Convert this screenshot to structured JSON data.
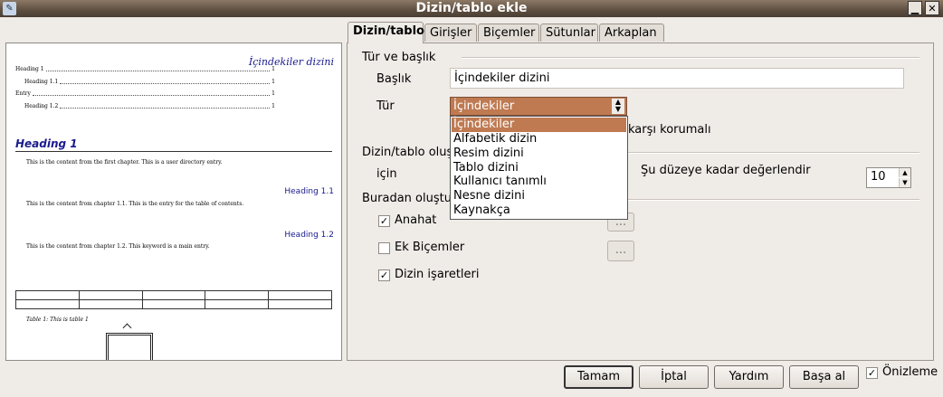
{
  "window": {
    "title": "Dizin/tablo ekle",
    "app_icon": "office-app-icon"
  },
  "tabs": [
    {
      "label": "Dizin/tablo"
    },
    {
      "label": "Girişler"
    },
    {
      "label": "Biçemler"
    },
    {
      "label": "Sütunlar"
    },
    {
      "label": "Arkaplan"
    }
  ],
  "preview": {
    "toc_title": "İçindekiler dizini",
    "toc_entries": [
      {
        "text": "Heading 1",
        "page": "1"
      },
      {
        "text": "Heading 1.1",
        "page": "1"
      },
      {
        "text": "Entry",
        "page": "1"
      },
      {
        "text": "Heading 1.2",
        "page": "1"
      }
    ],
    "heading1": "Heading 1",
    "body1": "This is the content from the first chapter. This is a user directory entry.",
    "heading11": "Heading 1.1",
    "body2": "This is the content from chapter 1.1. This is the entry for the table of contents.",
    "heading12": "Heading 1.2",
    "body3": "This is the content from chapter 1.2. This keyword is a main entry.",
    "caption": "Table 1: This is table 1"
  },
  "form": {
    "section_type": "Tür ve başlık",
    "title_label": "Başlık",
    "title_value": "İçindekiler dizini",
    "type_label": "Tür",
    "type_selected": "İçindekiler",
    "type_options": [
      "İçindekiler",
      "Alfabetik dizin",
      "Resim dizini",
      "Tablo dizini",
      "Kullanıcı tanımlı",
      "Nesne dizini",
      "Kaynakça"
    ],
    "protected_partial": "karşı korumalı",
    "section_create_partial": "Dizin/tablo oluş",
    "for_partial": "için",
    "evaluate_label": "Şu düzeye kadar değerlendir",
    "evaluate_value": "10",
    "create_from_partial": "Buradan oluştu",
    "outline_label": "Anahat",
    "outline_btn": "...",
    "extra_styles_label": "Ek Biçemler",
    "extra_styles_btn": "...",
    "index_marks_label": "Dizin işaretleri"
  },
  "buttons": {
    "ok": "Tamam",
    "cancel": "İptal",
    "help": "Yardım",
    "reset": "Başa al",
    "preview_label": "Önizleme"
  }
}
